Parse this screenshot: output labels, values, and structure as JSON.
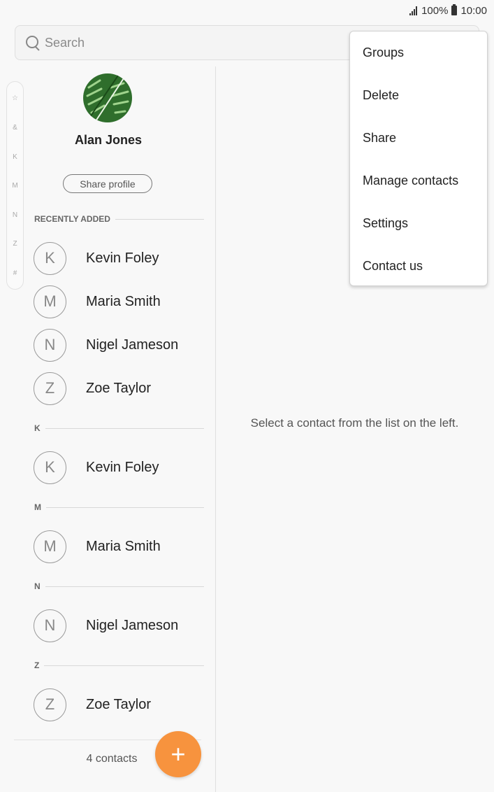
{
  "status_bar": {
    "battery": "100%",
    "time": "10:00"
  },
  "search": {
    "placeholder": "Search"
  },
  "index_scroller": {
    "items": [
      "☆",
      "&",
      "K",
      "M",
      "N",
      "Z",
      "#"
    ]
  },
  "profile": {
    "name": "Alan Jones",
    "share_label": "Share profile"
  },
  "sections": [
    {
      "header": "RECENTLY ADDED",
      "contacts": [
        {
          "initial": "K",
          "name": "Kevin Foley"
        },
        {
          "initial": "M",
          "name": "Maria Smith"
        },
        {
          "initial": "N",
          "name": "Nigel Jameson"
        },
        {
          "initial": "Z",
          "name": "Zoe Taylor"
        }
      ]
    },
    {
      "header": "K",
      "contacts": [
        {
          "initial": "K",
          "name": "Kevin Foley"
        }
      ]
    },
    {
      "header": "M",
      "contacts": [
        {
          "initial": "M",
          "name": "Maria Smith"
        }
      ]
    },
    {
      "header": "N",
      "contacts": [
        {
          "initial": "N",
          "name": "Nigel Jameson"
        }
      ]
    },
    {
      "header": "Z",
      "contacts": [
        {
          "initial": "Z",
          "name": "Zoe Taylor"
        }
      ]
    }
  ],
  "footer": {
    "count": "4 contacts",
    "fab_icon": "+"
  },
  "detail": {
    "empty_message": "Select a contact from the list on the left."
  },
  "menu": {
    "items": [
      "Groups",
      "Delete",
      "Share",
      "Manage contacts",
      "Settings",
      "Contact us"
    ]
  },
  "colors": {
    "accent": "#f7933e"
  }
}
